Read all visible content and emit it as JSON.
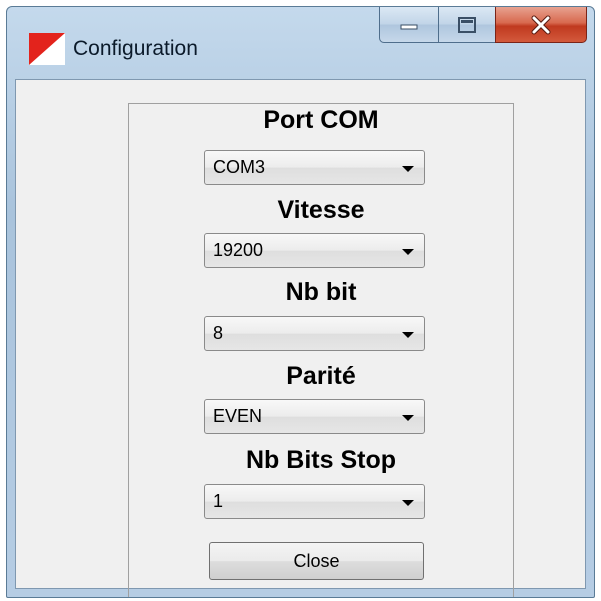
{
  "window": {
    "title": "Configuration"
  },
  "caption": {
    "minimize_icon": "minimize-icon",
    "maximize_icon": "maximize-icon",
    "close_icon": "close-icon"
  },
  "form": {
    "port": {
      "label": "Port COM",
      "value": "COM3"
    },
    "speed": {
      "label": "Vitesse",
      "value": "19200"
    },
    "databits": {
      "label": "Nb bit",
      "value": "8"
    },
    "parity": {
      "label": "Parité",
      "value": "EVEN"
    },
    "stopbits": {
      "label": "Nb Bits Stop",
      "value": "1"
    },
    "close_label": "Close"
  },
  "colors": {
    "close_button": "#c8412a",
    "client_bg": "#f0f0f0",
    "frame": "#b6cde4"
  }
}
